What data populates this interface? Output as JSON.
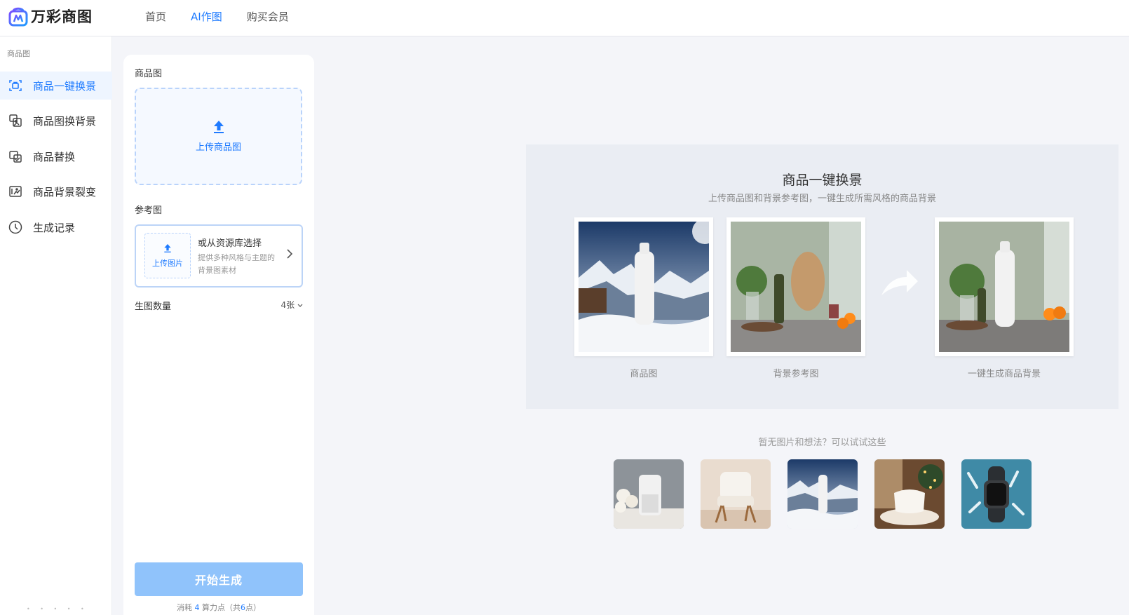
{
  "app": {
    "logo_text": "万彩商图"
  },
  "topnav": [
    {
      "label": "首页",
      "active": false
    },
    {
      "label": "AI作图",
      "active": true
    },
    {
      "label": "购买会员",
      "active": false
    }
  ],
  "sidebar": {
    "section_title": "商品图",
    "items": [
      {
        "label": "商品一键换景",
        "icon": "scan-product-icon",
        "active": true
      },
      {
        "label": "商品图换背景",
        "icon": "image-swap-icon",
        "active": false
      },
      {
        "label": "商品替换",
        "icon": "replace-icon",
        "active": false
      },
      {
        "label": "商品背景裂变",
        "icon": "gallery-icon",
        "active": false
      },
      {
        "label": "生成记录",
        "icon": "clock-icon",
        "active": false
      }
    ]
  },
  "panel": {
    "product_label": "商品图",
    "upload_product_text": "上传商品图",
    "reference_label": "参考图",
    "upload_image_text": "上传图片",
    "library_title": "或从资源库选择",
    "library_desc": "提供多种风格与主题的背景图素材",
    "count_label": "生图数量",
    "count_value": "4张",
    "generate_button": "开始生成",
    "cost_prefix": "消耗",
    "cost_amount": "4",
    "cost_unit": "算力点",
    "cost_total_prefix": "（共",
    "cost_total": "6",
    "cost_total_suffix": "点）"
  },
  "demo": {
    "title": "商品一键换景",
    "subtitle": "上传商品图和背景参考图，一键生成所需风格的商品背景",
    "captions": [
      "商品图",
      "背景参考图",
      "一键生成商品背景"
    ]
  },
  "suggestions": {
    "title": "暂无图片和想法？可以试试这些",
    "items": [
      "humidifier-thumbnail",
      "chair-thumbnail",
      "bottle-snow-thumbnail",
      "pillow-thumbnail",
      "watch-thumbnail"
    ]
  },
  "colors": {
    "accent": "#1f7bff",
    "button_disabled": "#90c3fb",
    "page_bg": "#f4f5f9"
  }
}
